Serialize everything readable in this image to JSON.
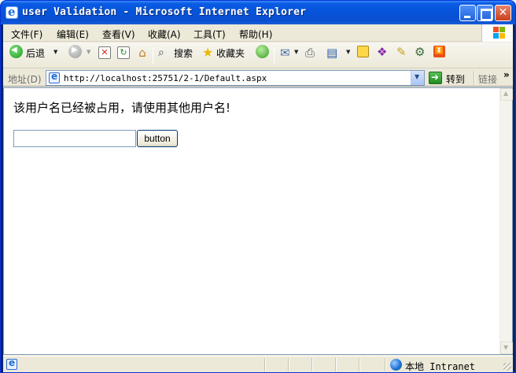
{
  "window": {
    "title": "user Validation - Microsoft Internet Explorer"
  },
  "menubar": {
    "items": [
      "文件(F)",
      "编辑(E)",
      "查看(V)",
      "收藏(A)",
      "工具(T)",
      "帮助(H)"
    ]
  },
  "toolbar": {
    "back_label": "后退",
    "search_label": "搜索",
    "favorites_label": "收藏夹"
  },
  "addressbar": {
    "label": "地址(D)",
    "url": "http://localhost:25751/2-1/Default.aspx",
    "go_label": "转到",
    "links_label": "链接"
  },
  "page": {
    "message": "该用户名已经被占用，请使用其他用户名!",
    "input_value": "",
    "button_label": "button"
  },
  "statusbar": {
    "zone_label": "本地 Intranet"
  }
}
